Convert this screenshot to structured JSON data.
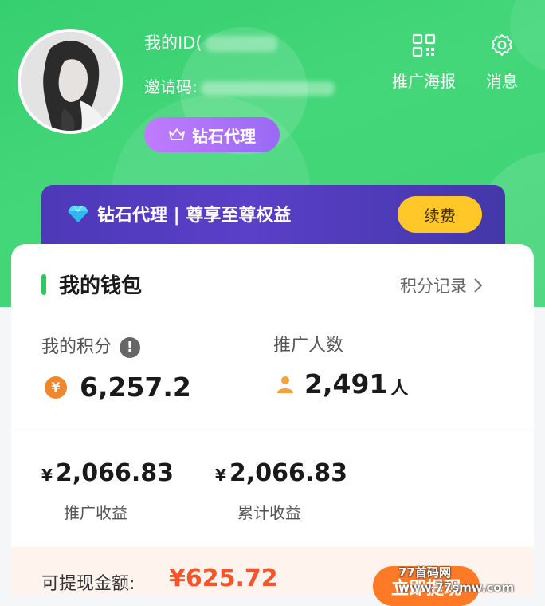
{
  "profile": {
    "id_label": "我的ID(",
    "invite_label": "邀请码:",
    "level_badge": "钻石代理"
  },
  "top_actions": {
    "poster_label": "推广海报",
    "message_label": "消息"
  },
  "vip": {
    "title": "钻石代理 | 尊享至尊权益",
    "renew_label": "续费"
  },
  "wallet": {
    "title": "我的钱包",
    "record_link": "积分记录",
    "points_label": "我的积分",
    "points_value": "6,257.2",
    "referrals_label": "推广人数",
    "referrals_value": "2,491",
    "referrals_unit": "人",
    "currency": "¥",
    "promo_income_value": "2,066.83",
    "promo_income_label": "推广收益",
    "total_income_value": "2,066.83",
    "total_income_label": "累计收益",
    "withdrawable_label": "可提现金额:",
    "withdrawable_value": "¥625.72",
    "withdraw_button": "立即提现"
  },
  "watermark": "77首码网 www.77smw.com",
  "colors": {
    "hero_green": "#3ed374",
    "vip_purple": "#4d39b8",
    "renew_yellow": "#ffc828",
    "accent_green": "#2ec764",
    "coin_orange": "#f0872f",
    "withdraw_orange": "#ff7a26"
  },
  "icons": {
    "level": "crown-icon",
    "poster": "qr-code-icon",
    "message": "gear-icon",
    "vip": "diamond-icon",
    "record": "chevron-right-icon",
    "info": "info-icon",
    "points": "yen-coin-icon",
    "referrals": "person-icon"
  }
}
